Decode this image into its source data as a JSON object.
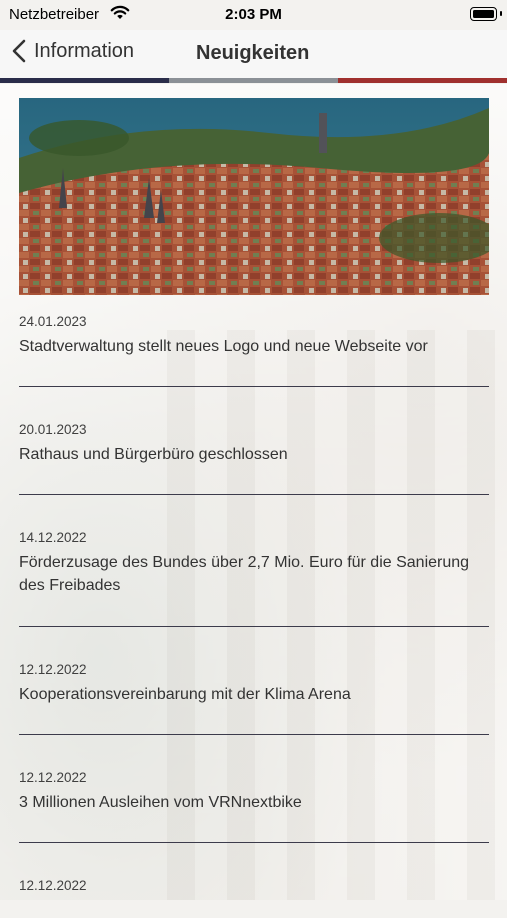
{
  "status_bar": {
    "carrier": "Netzbetreiber",
    "time": "2:03 PM"
  },
  "nav": {
    "back_label": "Information",
    "title": "Neuigkeiten"
  },
  "colors": {
    "stripe": [
      "#2a2d4a",
      "#8b9096",
      "#a0302e"
    ],
    "divider": "#3c3b4b"
  },
  "news": [
    {
      "date": "24.01.2023",
      "title": "Stadtverwaltung stellt neues Logo und neue Webseite vor"
    },
    {
      "date": "20.01.2023",
      "title": "Rathaus und Bürgerbüro geschlossen"
    },
    {
      "date": "14.12.2022",
      "title": "Förderzusage des Bundes über 2,7 Mio. Euro für die Sanierung des Freibades"
    },
    {
      "date": "12.12.2022",
      "title": "Kooperationsvereinbarung mit der Klima Arena"
    },
    {
      "date": "12.12.2022",
      "title": "3 Millionen Ausleihen vom VRNnextbike"
    },
    {
      "date": "12.12.2022",
      "title": ""
    }
  ]
}
